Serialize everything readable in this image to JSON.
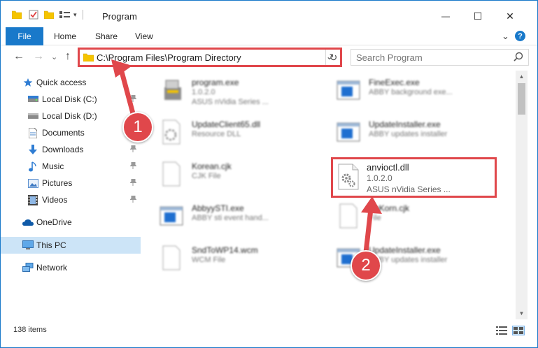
{
  "window": {
    "title": "Program",
    "minimize_glyph": "—",
    "maximize_glyph": "☐",
    "close_glyph": "✕"
  },
  "ribbon": {
    "tabs": [
      "File",
      "Home",
      "Share",
      "View"
    ],
    "help_glyph": "?",
    "expand_glyph": "⌄"
  },
  "navigation": {
    "back_glyph": "←",
    "forward_glyph": "→",
    "recent_glyph": "⌄",
    "up_glyph": "↑"
  },
  "address": {
    "path": "C:\\Program Files\\Program Directory",
    "dropdown_glyph": "⌄",
    "refresh_glyph": "↻"
  },
  "search": {
    "placeholder": "Search Program"
  },
  "sidebar": {
    "items": [
      {
        "label": "Quick access",
        "icon": "star-icon",
        "pinned": false
      },
      {
        "label": "Local Disk (C:)",
        "icon": "drive-icon",
        "pinned": true
      },
      {
        "label": "Local Disk (D:)",
        "icon": "drive-icon",
        "pinned": false
      },
      {
        "label": "Documents",
        "icon": "document-icon",
        "pinned": true
      },
      {
        "label": "Downloads",
        "icon": "download-icon",
        "pinned": true
      },
      {
        "label": "Music",
        "icon": "music-icon",
        "pinned": true
      },
      {
        "label": "Pictures",
        "icon": "picture-icon",
        "pinned": true
      },
      {
        "label": "Videos",
        "icon": "video-icon",
        "pinned": true
      },
      {
        "label": "OneDrive",
        "icon": "cloud-icon",
        "pinned": false
      },
      {
        "label": "This PC",
        "icon": "computer-icon",
        "pinned": false,
        "selected": true
      },
      {
        "label": "Network",
        "icon": "network-icon",
        "pinned": false
      }
    ],
    "pin_glyph": "📌"
  },
  "files": [
    {
      "name": "program.exe",
      "line1": "1.0.2.0",
      "line2": "ASUS nVidia Series ...",
      "icon": "installer-icon"
    },
    {
      "name": "FineExec.exe",
      "line1": "ABBY background exe...",
      "line2": "",
      "icon": "app-window-icon"
    },
    {
      "name": "UpdateClient65.dll",
      "line1": "Resource DLL",
      "line2": "",
      "icon": "dll-icon"
    },
    {
      "name": "UpdateInstaller.exe",
      "line1": "ABBY updates installer",
      "line2": "",
      "icon": "app-window-icon"
    },
    {
      "name": "Korean.cjk",
      "line1": "CJK File",
      "line2": "",
      "icon": "file-icon"
    },
    {
      "name": "anvioctl.dll",
      "line1": "1.0.2.0",
      "line2": "ASUS nVidia Series ...",
      "icon": "dll-icon",
      "highlighted": true
    },
    {
      "name": "AbbyySTI.exe",
      "line1": "ABBY sti event hand...",
      "line2": "",
      "icon": "app-window-icon"
    },
    {
      "name": "AnKorn.cjk",
      "line1": "File",
      "line2": "",
      "icon": "file-icon"
    },
    {
      "name": "SndToWP14.wcm",
      "line1": "WCM File",
      "line2": "",
      "icon": "file-icon"
    },
    {
      "name": "UpdateInstaller.exe",
      "line1": "ABBY updates installer",
      "line2": "",
      "icon": "app-window-icon"
    }
  ],
  "status": {
    "item_count": "138 items"
  },
  "callouts": [
    {
      "number": "1"
    },
    {
      "number": "2"
    }
  ],
  "colors": {
    "accent": "#1979ca",
    "callout_red": "#e0474b",
    "selection": "#cce4f7"
  }
}
